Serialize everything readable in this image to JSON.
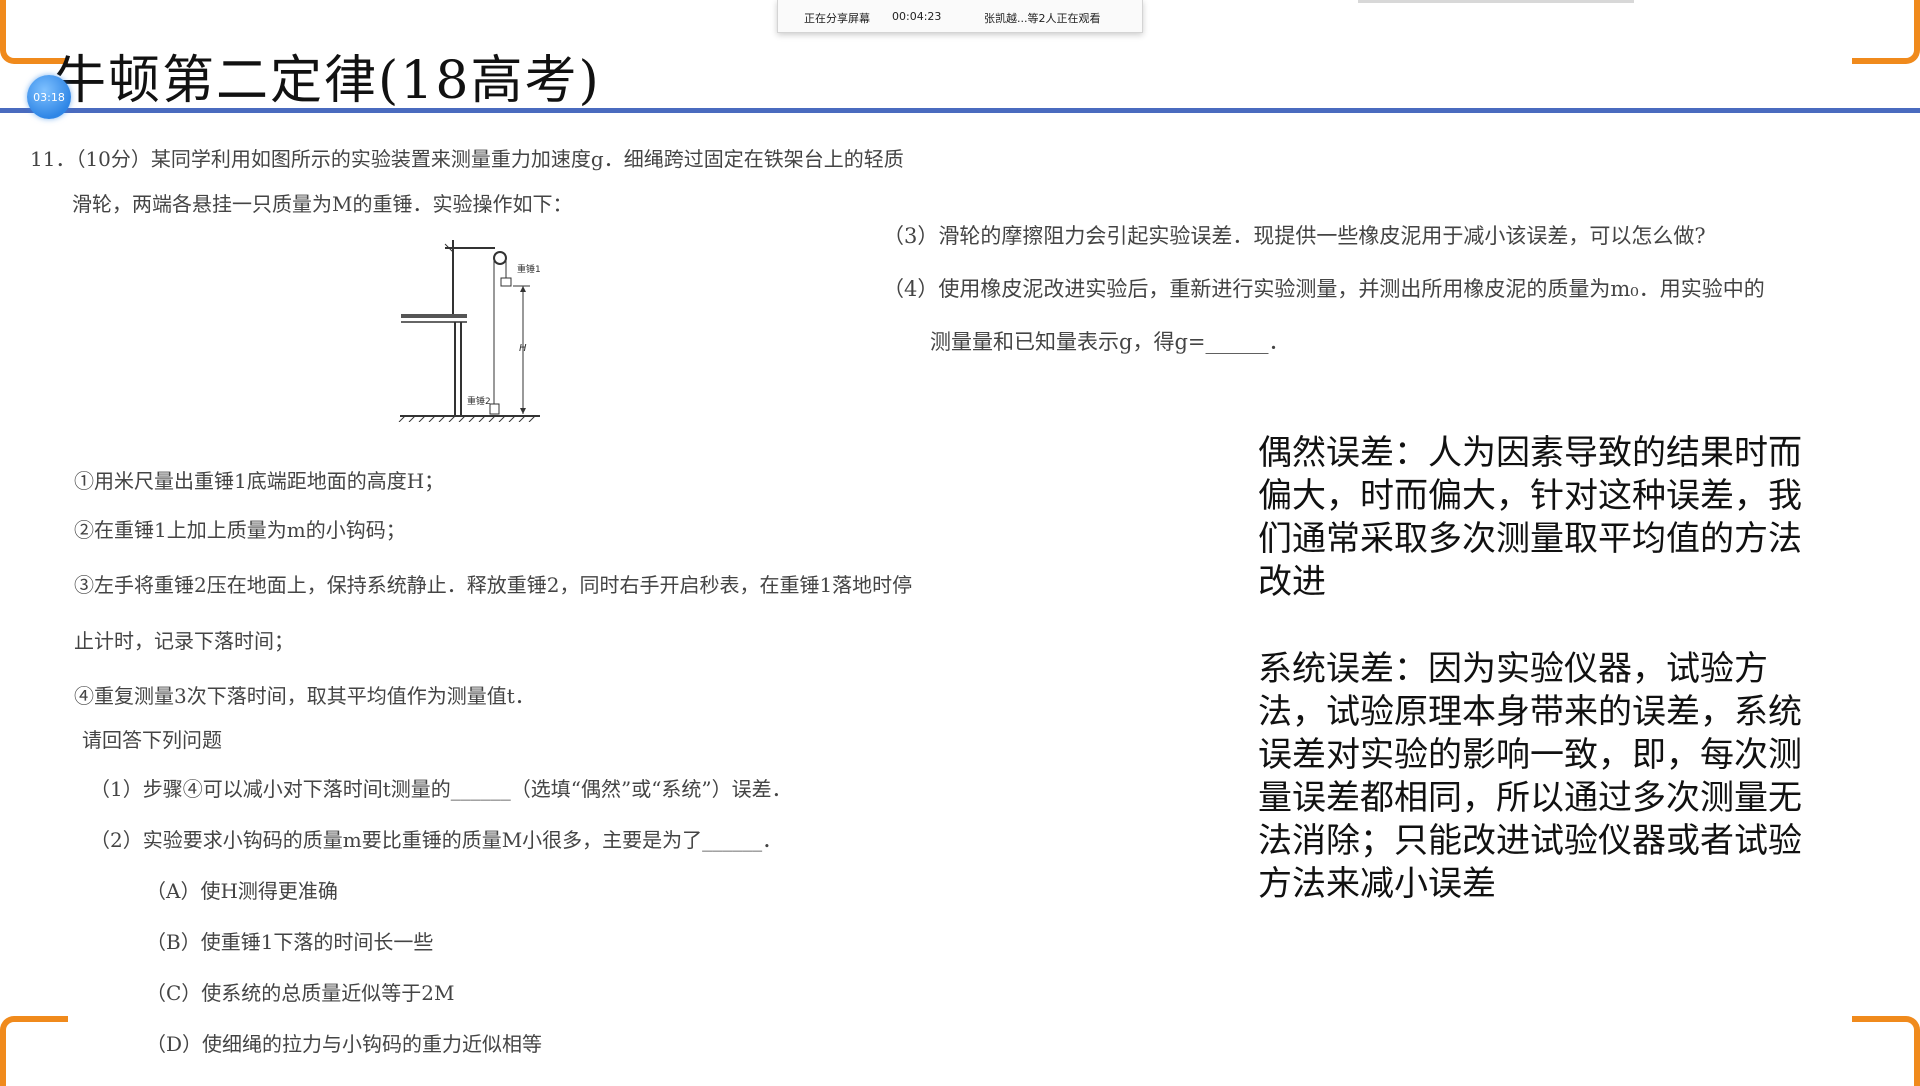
{
  "share_bar": {
    "status": "正在分享屏幕",
    "elapsed": "00:04:23",
    "viewers": "张凯越...等2人正在观看"
  },
  "timer_badge": "03:18",
  "slide": {
    "title": "牛顿第二定律(18高考)",
    "question_header": "11．（10分）某同学利用如图所示的实验装置来测量重力加速度g．细绳跨过固定在铁架台上的轻质",
    "question_header2": "滑轮，两端各悬挂一只质量为M的重锤．实验操作如下：",
    "q3": "（3）滑轮的摩擦阻力会引起实验误差．现提供一些橡皮泥用于减小该误差，可以怎么做?",
    "q4_line1": "（4）使用橡皮泥改进实验后，重新进行实验测量，并测出所用橡皮泥的质量为m₀．用实验中的",
    "q4_line2": "测量量和已知量表示g，得g=______．",
    "figure": {
      "label_weight1": "重锤1",
      "label_weight2": "重锤2",
      "label_height": "H"
    },
    "steps": [
      "①用米尺量出重锤1底端距地面的高度H；",
      "②在重锤1上加上质量为m的小钩码；",
      "③左手将重锤2压在地面上，保持系统静止．释放重锤2，同时右手开启秒表，在重锤1落地时停",
      "止计时，记录下落时间；",
      "④重复测量3次下落时间，取其平均值作为测量值t．"
    ],
    "prompt": "请回答下列问题",
    "q1": "（1）步骤④可以减小对下落时间t测量的______（选填“偶然”或“系统”）误差．",
    "q2": "（2）实验要求小钩码的质量m要比重锤的质量M小很多，主要是为了______．",
    "options": [
      "（A）使H测得更准确",
      "（B）使重锤1下落的时间长一些",
      "（C）使系统的总质量近似等于2M",
      "（D）使细绳的拉力与小钩码的重力近似相等"
    ],
    "notes": {
      "random_error": "偶然误差：人为因素导致的结果时而偏大，时而偏大，针对这种误差，我们通常采取多次测量取平均值的方法改进",
      "systematic_error": "系统误差：因为实验仪器，试验方法，试验原理本身带来的误差，系统误差对实验的影响一致，即，每次测量误差都相同，所以通过多次测量无法消除；只能改进试验仪器或者试验方法来减小误差"
    }
  },
  "colors": {
    "accent_orange": "#f08a1c",
    "title_rule_blue": "#4a6bbf",
    "timer_blue": "#2f86e6"
  }
}
